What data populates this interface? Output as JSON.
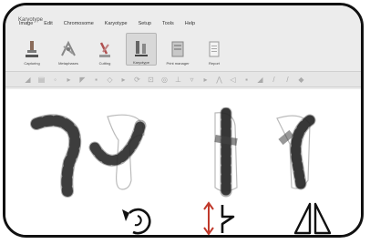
{
  "window": {
    "title": "Karyotype"
  },
  "menubar": {
    "items": [
      "Image",
      "Edit",
      "Chromosome",
      "Karyotype",
      "Setup",
      "Tools",
      "Help"
    ]
  },
  "ribbon": {
    "buttons": [
      {
        "label": "Capturing",
        "icon": "microscope-icon"
      },
      {
        "label": "Metaphases",
        "icon": "metaphase-icon"
      },
      {
        "label": "Cutting",
        "icon": "cutting-icon"
      },
      {
        "label": "Karyotype",
        "icon": "karyotype-icon",
        "active": true
      },
      {
        "label": "Print manager",
        "icon": "print-icon"
      },
      {
        "label": "Report",
        "icon": "report-icon"
      }
    ]
  },
  "toolbar": {
    "icon_count": 24
  },
  "controls": [
    {
      "name": "rotate-control",
      "icon": "rotate-icon"
    },
    {
      "name": "flip-vertical-control",
      "icon": "flip-vertical-icon"
    },
    {
      "name": "mirror-control",
      "icon": "mirror-icon"
    }
  ]
}
